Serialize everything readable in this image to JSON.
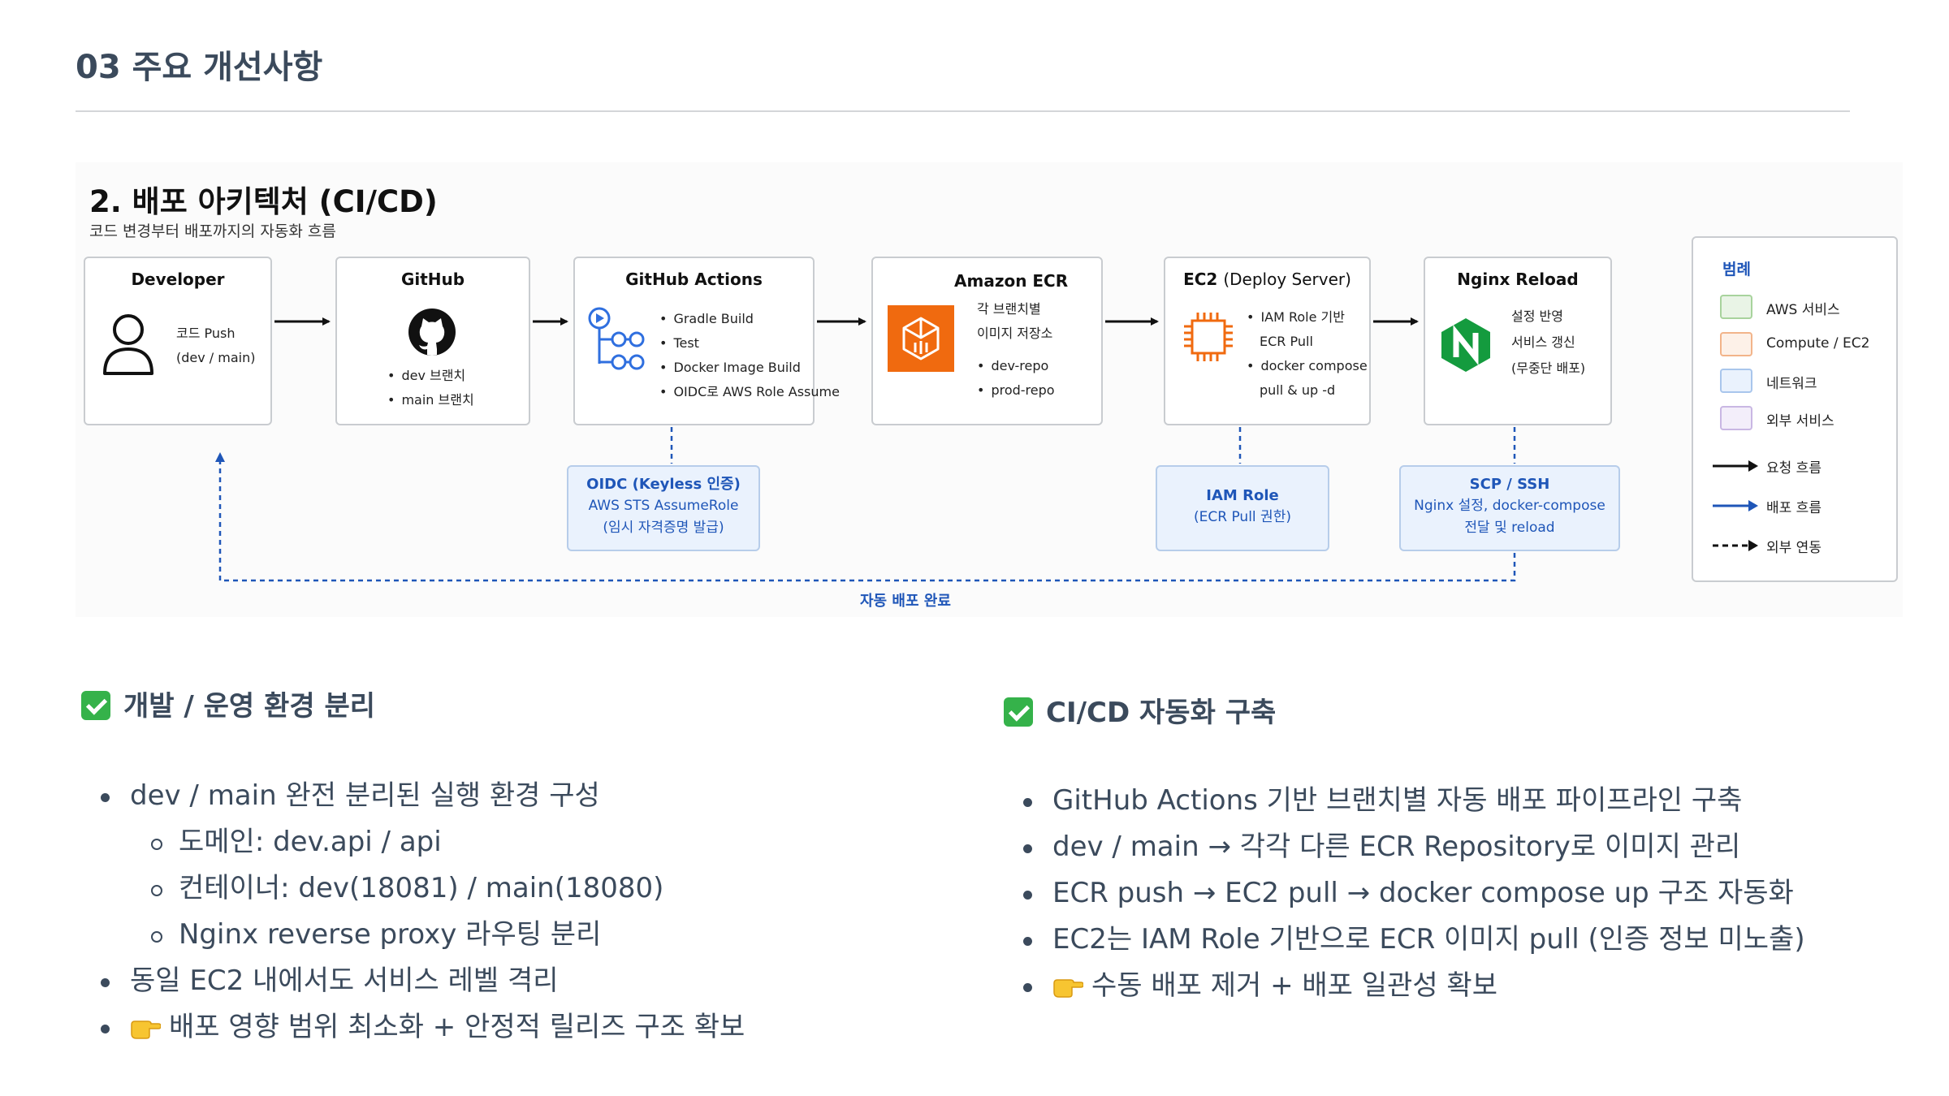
{
  "page": {
    "title": "03 주요 개선사항"
  },
  "diagram": {
    "title": "2. 배포 아키텍처 (CI/CD)",
    "subtitle": "코드 변경부터 배포까지의 자동화 흐름",
    "nodes": {
      "developer": {
        "title": "Developer",
        "lines": [
          "코드 Push",
          "(dev / main)"
        ],
        "icon": "person-icon"
      },
      "github": {
        "title": "GitHub",
        "items": [
          "dev 브랜치",
          "main 브랜치"
        ],
        "icon": "github-icon"
      },
      "actions": {
        "title": "GitHub Actions",
        "items": [
          "Gradle Build",
          "Test",
          "Docker Image Build",
          "OIDC로 AWS Role Assume"
        ],
        "icon": "github-actions-icon"
      },
      "ecr": {
        "title": "Amazon ECR",
        "lines": [
          "각 브랜치별",
          "이미지 저장소"
        ],
        "items": [
          "dev-repo",
          "prod-repo"
        ],
        "icon": "ecr-icon",
        "icon_color": "#f06a0f"
      },
      "ec2": {
        "title_main": "EC2",
        "title_sub": "(Deploy Server)",
        "items": [
          "IAM Role 기반",
          "ECR Pull",
          "docker compose",
          "pull & up -d"
        ],
        "icon": "ec2-chip-icon",
        "icon_color": "#f06a0f"
      },
      "nginx": {
        "title": "Nginx Reload",
        "lines": [
          "설정 반영",
          "서비스 갱신",
          "(무중단 배포)"
        ],
        "icon": "nginx-icon",
        "icon_color": "#149b3e"
      }
    },
    "subs": {
      "oidc": {
        "title": "OIDC (Keyless 인증)",
        "lines": [
          "AWS STS AssumeRole",
          "(임시 자격증명 발급)"
        ]
      },
      "iam": {
        "title": "IAM Role",
        "lines": [
          "(ECR Pull 권한)"
        ]
      },
      "scp": {
        "title": "SCP / SSH",
        "lines": [
          "Nginx 설정, docker-compose",
          "전달 및 reload"
        ]
      }
    },
    "done_label": "자동 배포 완료",
    "legend": {
      "title": "범례",
      "items": [
        {
          "label": "AWS 서비스",
          "fill": "#e9f4e6",
          "border": "#a8d39d"
        },
        {
          "label": "Compute / EC2",
          "fill": "#fdf1e8",
          "border": "#f2b48a"
        },
        {
          "label": "네트워크",
          "fill": "#eaf2fd",
          "border": "#a9c6ec"
        },
        {
          "label": "외부 서비스",
          "fill": "#f3eefa",
          "border": "#c9b7e3"
        }
      ],
      "arrows": [
        {
          "label": "요청 흐름",
          "style": "solid",
          "color": "#111111"
        },
        {
          "label": "배포 흐름",
          "style": "solid",
          "color": "#1f56b8"
        },
        {
          "label": "외부 연동",
          "style": "dashed",
          "color": "#111111"
        }
      ]
    },
    "colors": {
      "accent_blue": "#1f56b8",
      "border": "#c9ccd0"
    }
  },
  "section_left": {
    "heading": "개발 / 운영 환경 분리",
    "bullets": [
      {
        "level": 1,
        "text": "dev / main 완전 분리된 실행 환경 구성"
      },
      {
        "level": 2,
        "text": "도메인: dev.api / api"
      },
      {
        "level": 2,
        "text": "컨테이너: dev(18081) / main(18080)"
      },
      {
        "level": 2,
        "text": "Nginx reverse proxy 라우팅 분리"
      },
      {
        "level": 1,
        "text": "동일 EC2 내에서도 서비스 레벨 격리"
      },
      {
        "level": 1,
        "text": "배포 영향 범위 최소화 + 안정적 릴리즈 구조 확보",
        "icon": "pointing-hand-icon"
      }
    ]
  },
  "section_right": {
    "heading": "CI/CD 자동화 구축",
    "bullets": [
      {
        "level": 1,
        "text": "GitHub Actions 기반 브랜치별 자동 배포 파이프라인 구축"
      },
      {
        "level": 1,
        "text": "dev / main → 각각 다른 ECR Repository로 이미지 관리"
      },
      {
        "level": 1,
        "text": "ECR push → EC2 pull → docker compose up 구조 자동화"
      },
      {
        "level": 1,
        "text": "EC2는 IAM Role 기반으로 ECR 이미지 pull (인증 정보 미노출)"
      },
      {
        "level": 1,
        "text": "수동 배포 제거 + 배포 일관성 확보",
        "icon": "pointing-hand-icon"
      }
    ]
  },
  "icons": {
    "check": "check-mark-icon",
    "check_color": "#35b24a"
  }
}
